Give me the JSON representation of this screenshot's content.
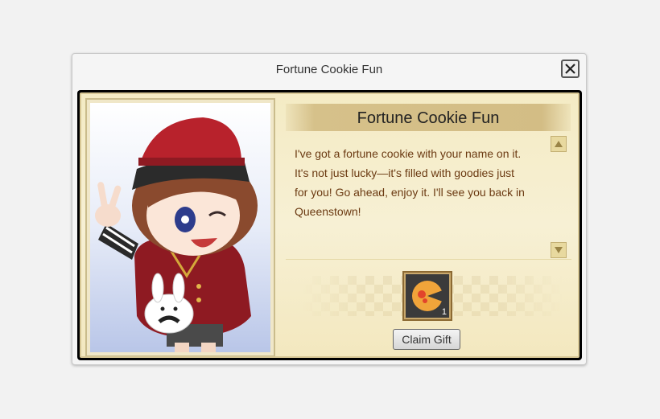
{
  "window": {
    "title": "Fortune Cookie Fun",
    "close_icon": "close-icon"
  },
  "dialog": {
    "heading": "Fortune Cookie Fun",
    "lines": [
      "I've got a fortune cookie with your name on it.",
      "It's not just lucky—it's filled with goodies just",
      "for you! Go ahead, enjoy it. I'll see you back in",
      "Queenstown!"
    ]
  },
  "gift": {
    "icon": "fortune-cookie-icon",
    "quantity": "1"
  },
  "buttons": {
    "claim_label": "Claim Gift"
  },
  "colors": {
    "dialog_text": "#6b3a12",
    "panel_bg": "#f4ebc4",
    "frame": "#000000"
  }
}
